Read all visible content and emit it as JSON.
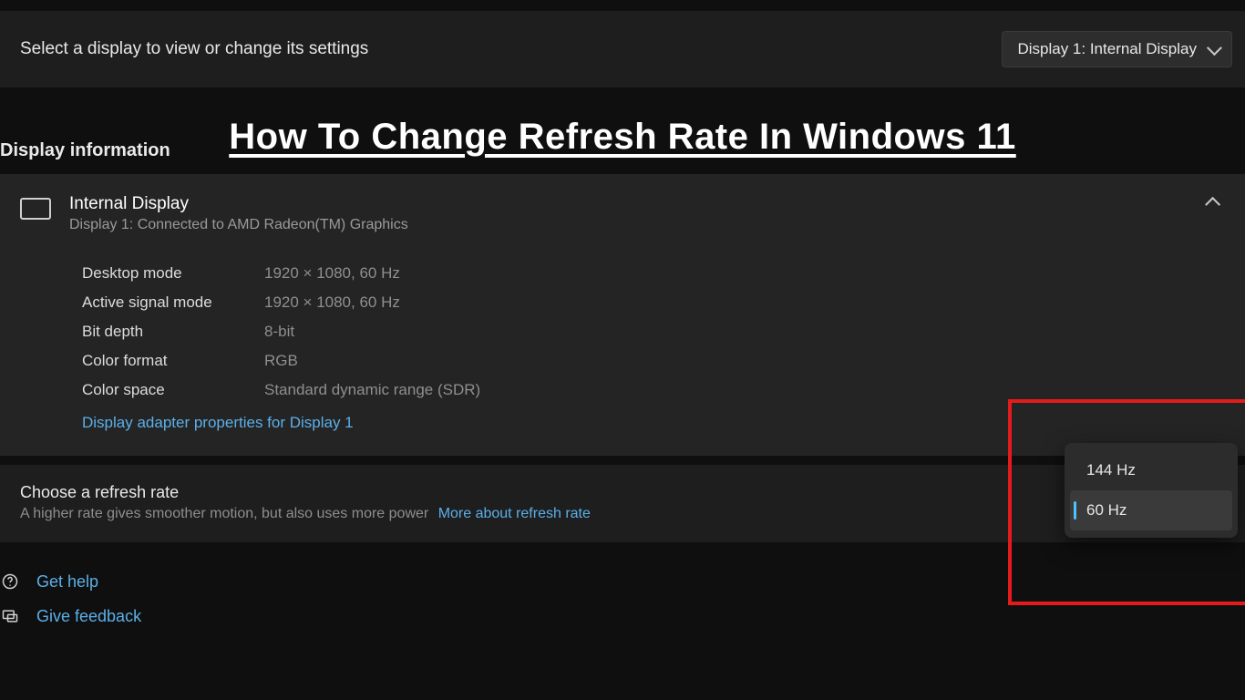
{
  "overlay_title": "How To Change Refresh Rate In Windows 11",
  "selector": {
    "label": "Select a display to view or change its settings",
    "value": "Display 1: Internal Display"
  },
  "section_header": "Display information",
  "display_card": {
    "title": "Internal Display",
    "subtitle": "Display 1: Connected to AMD Radeon(TM) Graphics"
  },
  "properties": [
    {
      "label": "Desktop mode",
      "value": "1920 × 1080, 60 Hz"
    },
    {
      "label": "Active signal mode",
      "value": "1920 × 1080, 60 Hz"
    },
    {
      "label": "Bit depth",
      "value": "8-bit"
    },
    {
      "label": "Color format",
      "value": "RGB"
    },
    {
      "label": "Color space",
      "value": "Standard dynamic range (SDR)"
    }
  ],
  "adapter_link": "Display adapter properties for Display 1",
  "refresh": {
    "title": "Choose a refresh rate",
    "subtitle": "A higher rate gives smoother motion, but also uses more power",
    "more_link": "More about refresh rate"
  },
  "rate_popup": {
    "options": [
      {
        "label": "144 Hz",
        "selected": false
      },
      {
        "label": "60 Hz",
        "selected": true
      }
    ]
  },
  "help": {
    "get_help": "Get help",
    "give_feedback": "Give feedback"
  }
}
